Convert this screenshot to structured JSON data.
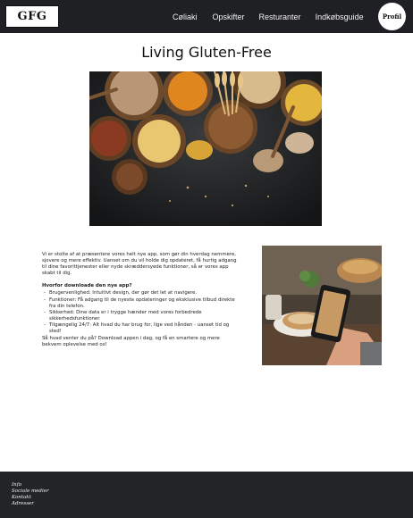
{
  "header": {
    "logo": "GFG",
    "nav": [
      "Cøliaki",
      "Opskifter",
      "Resturanter",
      "Indkøbsguide"
    ],
    "profile_label": "Profil"
  },
  "page_title": "Living Gluten-Free",
  "intro": "Vi er stolte af at præsentere vores helt nye app, som gør din hverdag nemmere, sjovere og mere effektiv. Uanset om du vil holde dig opdateret, få hurtig adgang til dine favorittjenester eller nyde skræddersyede funktioner, så er vores app skabt til dig.",
  "why_heading": "Hvorfor downloade den nye app?",
  "features": [
    "Brugervenlighed: Intuitivt design, der gør det let at navigere.",
    "Funktioner: Få adgang til de nyeste opdateringer og eksklusive tilbud direkte fra din telefon.",
    "Sikkerhed: Dine data er i trygge hænder med vores forbedrede sikkerhedsfunktioner.",
    "Tilgængelig 24/7: Alt hvad du har brug for, lige ved hånden - uanset tid og sted!",
    ""
  ],
  "closing": "Så hvad venter du på? Download appen i dag, og få en smartere og mere bekvem oplevelse med os!",
  "footer": {
    "links": [
      "Info",
      "Sociale medier",
      "Kontakt",
      "Adresser"
    ]
  },
  "colors": {
    "header_bg": "#1f2024",
    "footer_bg": "#232428",
    "text": "#1e1e1e"
  },
  "images": {
    "hero": "grains-and-seeds-photo",
    "side": "phone-photographing-bread-photo"
  }
}
